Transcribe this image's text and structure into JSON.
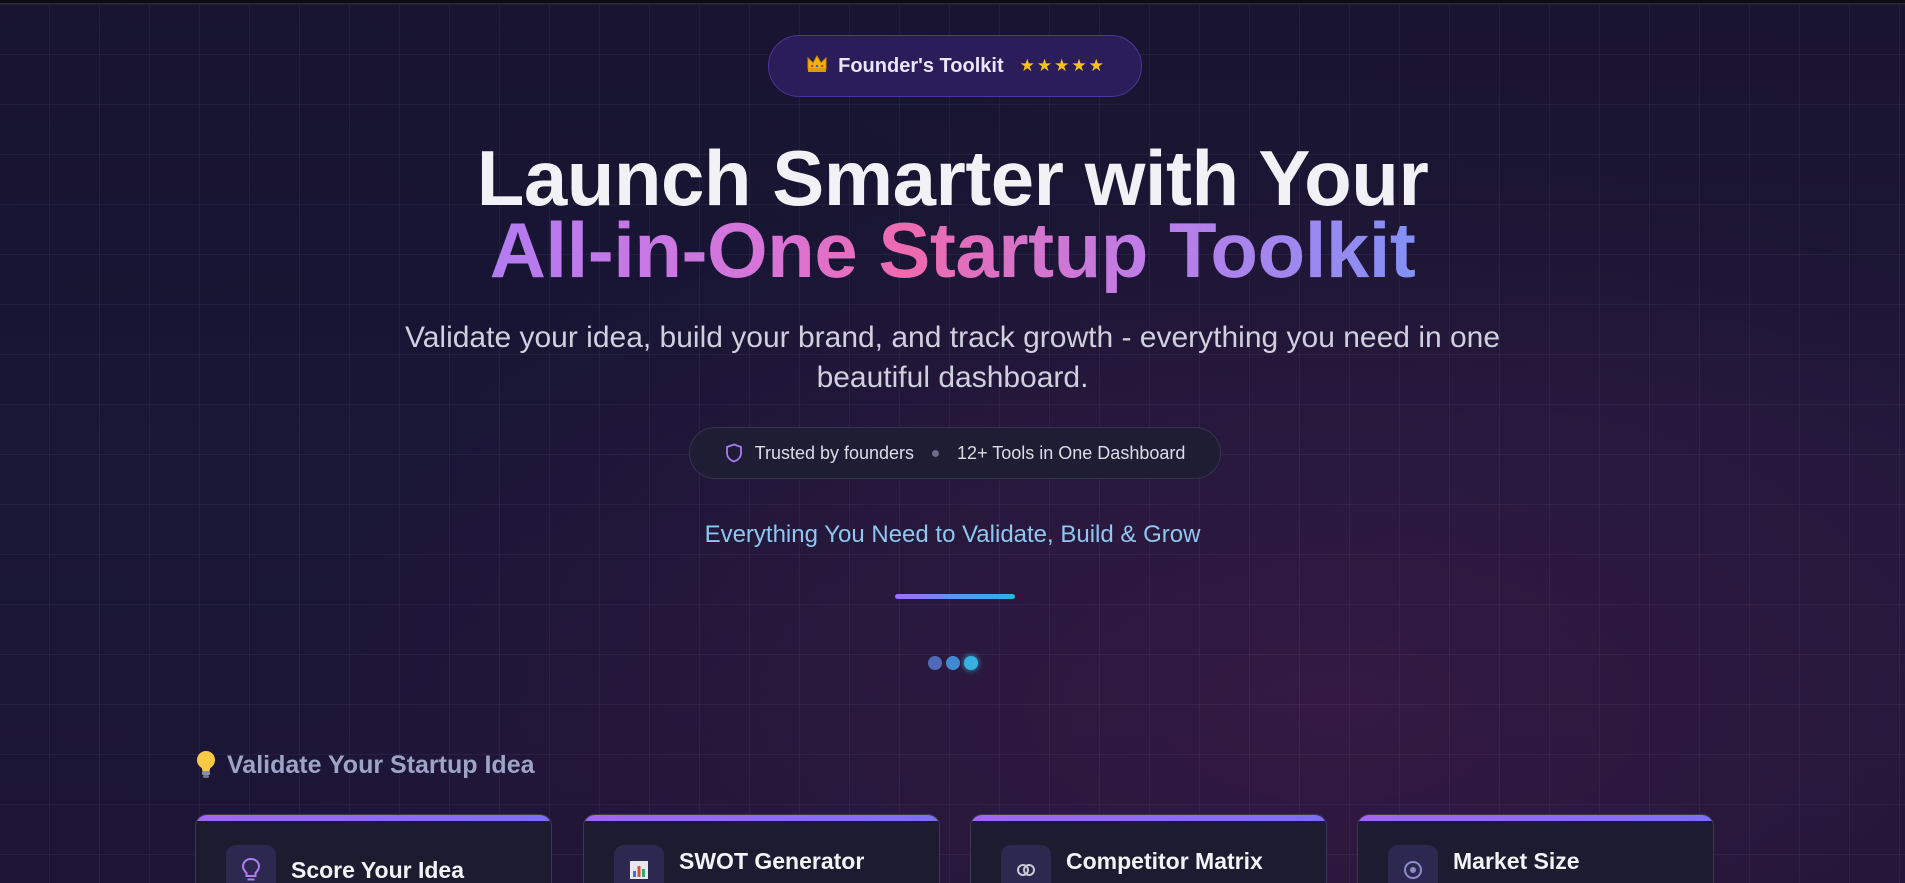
{
  "badge": {
    "icon": "crown-icon",
    "label": "Founder's Toolkit",
    "rating": "5 of 5 stars"
  },
  "hero": {
    "title_line1": "Launch Smarter with Your",
    "title_line2": "All-in-One Startup Toolkit",
    "subtitle": "Validate your idea, build your brand, and track growth - everything you need in one beautiful dashboard."
  },
  "trust": {
    "icon": "shield-icon",
    "item1": "Trusted by founders",
    "item2": "12+ Tools in One Dashboard"
  },
  "tagline": "Everything You Need to Validate, Build & Grow",
  "loader": {
    "colors": [
      "#4f6bb8",
      "#3f8ad0",
      "#38b0e0"
    ]
  },
  "section": {
    "icon": "lightbulb-icon",
    "title": "Validate Your Startup Idea"
  },
  "cards": [
    {
      "icon": "lightbulb-outline-icon",
      "title": "Score Your Idea"
    },
    {
      "icon": "bar-chart-icon",
      "title": "SWOT Generator"
    },
    {
      "icon": "matrix-icon",
      "title": "Competitor Matrix"
    },
    {
      "icon": "market-icon",
      "title": "Market Size"
    }
  ],
  "colors": {
    "accent_purple": "#a366f0",
    "accent_cyan": "#28b5de",
    "star": "#f7c21b",
    "tagline": "#8ec7f0"
  }
}
